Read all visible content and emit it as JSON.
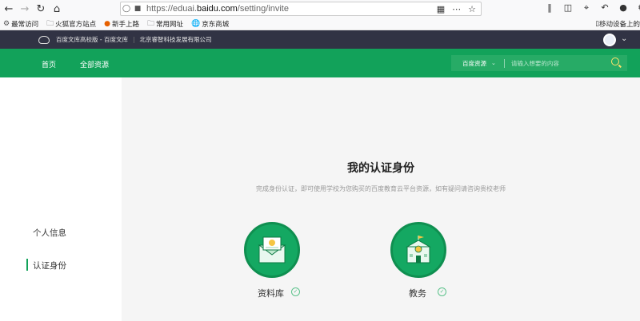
{
  "browser": {
    "url_prefix": "https://eduai.",
    "url_domain": "baidu.com",
    "url_path": "/setting/invite"
  },
  "bookmarks": {
    "items": [
      "最常访问",
      "火狐官方站点",
      "新手上路",
      "常用网址",
      "京东商城"
    ],
    "mobile": "移动设备上的"
  },
  "site_header": {
    "name": "百度文库高校版 - 百度文库",
    "company": "北京睿智科技发展有限公司"
  },
  "nav": {
    "home": "首页",
    "all_resources": "全部资源",
    "search_category": "百度资源",
    "search_placeholder": "请输入想要的内容"
  },
  "sidebar": {
    "items": [
      {
        "label": "个人信息",
        "active": false
      },
      {
        "label": "认证身份",
        "active": true
      }
    ]
  },
  "main": {
    "title": "我的认证身份",
    "subtitle": "完成身份认证，即可使用学校为您购买的百度教育云平台资源，如有疑问请咨询贵校老师",
    "cards": [
      {
        "label": "资料库",
        "icon": "certificate-icon",
        "verified": true
      },
      {
        "label": "教务",
        "icon": "school-building-icon",
        "verified": true
      }
    ]
  },
  "colors": {
    "brand_green": "#12a25a",
    "header_dark": "#313344"
  }
}
